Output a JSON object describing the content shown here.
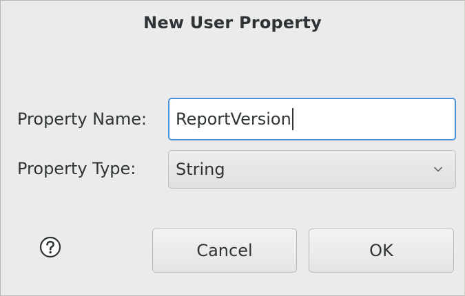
{
  "dialog": {
    "title": "New User Property"
  },
  "form": {
    "name_label": "Property Name:",
    "name_value": "ReportVersion",
    "type_label": "Property Type:",
    "type_value": "String"
  },
  "buttons": {
    "cancel_label": "Cancel",
    "ok_label": "OK"
  },
  "icons": {
    "help": "help-question-icon",
    "dropdown": "chevron-down-icon"
  },
  "colors": {
    "focus_border": "#4a90d9",
    "dialog_background": "#ebebeb",
    "text": "#2e3436"
  }
}
